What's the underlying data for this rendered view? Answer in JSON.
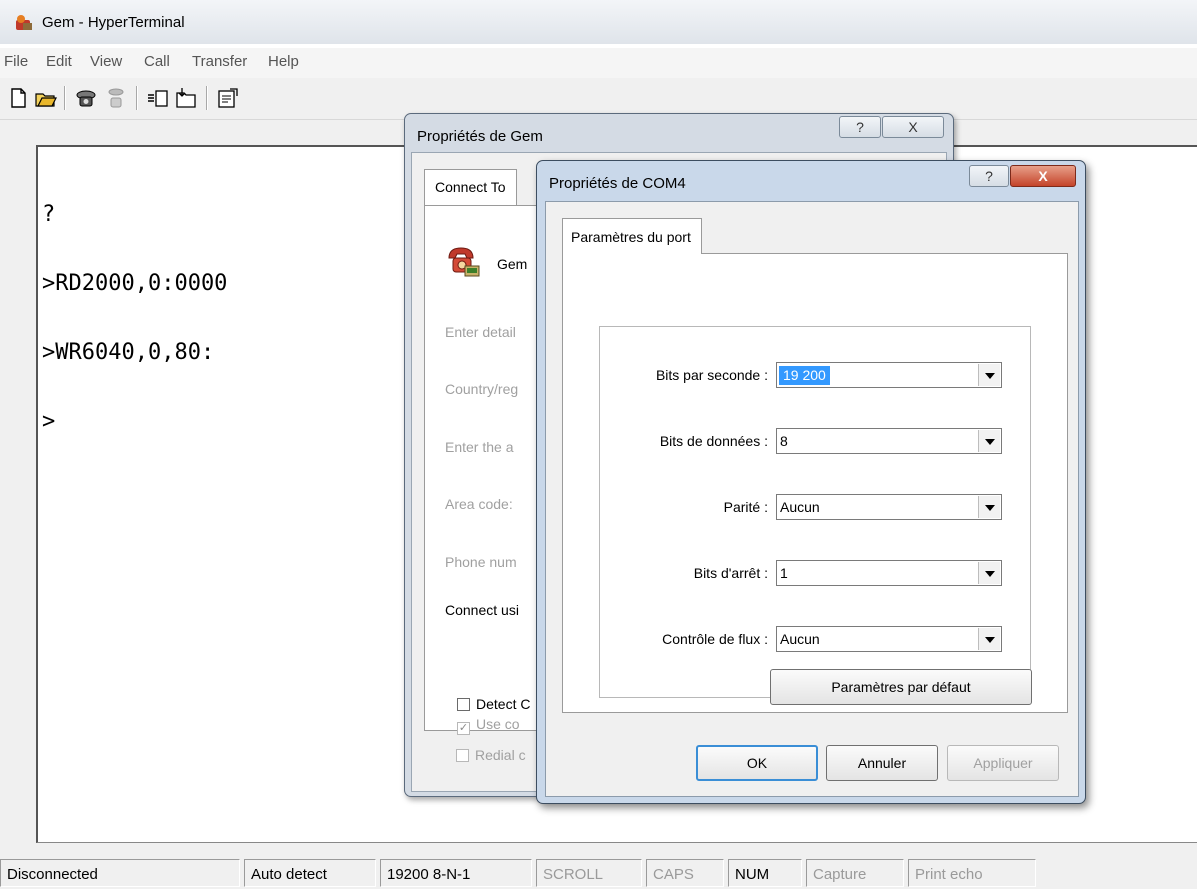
{
  "window": {
    "title": "Gem - HyperTerminal"
  },
  "menu": [
    "File",
    "Edit",
    "View",
    "Call",
    "Transfer",
    "Help"
  ],
  "toolbar": {
    "icons": [
      "new-file-icon",
      "open-folder-icon",
      "phone-connect-icon",
      "phone-disconnect-icon",
      "send-icon",
      "receive-icon",
      "properties-icon"
    ]
  },
  "terminal": {
    "lines": [
      "?",
      ">RD2000,0:0000",
      ">WR6040,0,80:",
      ">"
    ]
  },
  "statusbar": [
    {
      "text": "Disconnected",
      "enabled": true
    },
    {
      "text": "Auto detect",
      "enabled": true
    },
    {
      "text": "19200 8-N-1",
      "enabled": true
    },
    {
      "text": "SCROLL",
      "enabled": false
    },
    {
      "text": "CAPS",
      "enabled": false
    },
    {
      "text": "NUM",
      "enabled": true
    },
    {
      "text": "Capture",
      "enabled": false
    },
    {
      "text": "Print echo",
      "enabled": false
    }
  ],
  "dialog_gem": {
    "title": "Propriétés de Gem",
    "help": "?",
    "close": "X",
    "tab": "Connect To",
    "connection_name": "Gem",
    "rows": [
      "Enter detail",
      "Country/reg",
      "Enter the a",
      "Area code:",
      "Phone num"
    ],
    "connect_using": "Connect usi",
    "checkboxes": [
      {
        "label": "Detect C",
        "checked": false,
        "enabled": true
      },
      {
        "label": "Use co",
        "checked": true,
        "enabled": false
      },
      {
        "label": "Redial c",
        "checked": false,
        "enabled": false
      }
    ]
  },
  "dialog_com": {
    "title": "Propriétés de COM4",
    "help": "?",
    "close": "X",
    "tab": "Paramètres du port",
    "fields": [
      {
        "label": "Bits par seconde :",
        "value": "19 200"
      },
      {
        "label": "Bits de données :",
        "value": "8"
      },
      {
        "label": "Parité :",
        "value": "Aucun"
      },
      {
        "label": "Bits d'arrêt :",
        "value": "1"
      },
      {
        "label": "Contrôle de flux :",
        "value": "Aucun"
      }
    ],
    "defaults_button": "Paramètres par défaut",
    "ok": "OK",
    "cancel": "Annuler",
    "apply": "Appliquer"
  }
}
